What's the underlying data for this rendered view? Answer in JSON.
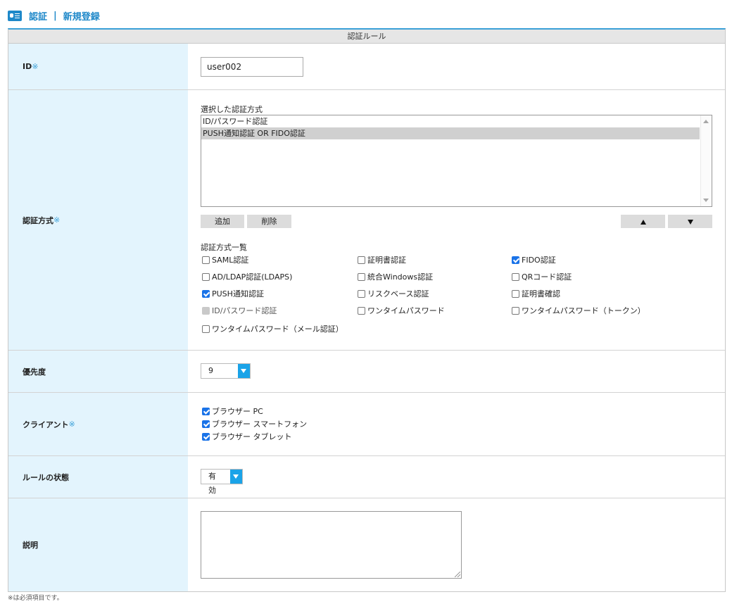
{
  "header": {
    "breadcrumb_1": "認証",
    "separator": "|",
    "breadcrumb_2": "新規登録",
    "icon": "id-card-icon"
  },
  "section_title": "認証ルール",
  "required_mark": "※",
  "id_field": {
    "label": "ID",
    "value": "user002"
  },
  "auth_method": {
    "label": "認証方式",
    "selected_heading": "選択した認証方式",
    "selected_items": [
      "ID/パスワード認証",
      "PUSH通知認証 OR FIDO認証"
    ],
    "selected_index": 1,
    "add_button": "追加",
    "delete_button": "削除",
    "list_heading": "認証方式一覧",
    "options": [
      {
        "label": "SAML認証",
        "checked": false,
        "disabled": false
      },
      {
        "label": "証明書認証",
        "checked": false,
        "disabled": false
      },
      {
        "label": "FIDO認証",
        "checked": true,
        "disabled": false
      },
      {
        "label": "AD/LDAP認証(LDAPS)",
        "checked": false,
        "disabled": false
      },
      {
        "label": "統合Windows認証",
        "checked": false,
        "disabled": false
      },
      {
        "label": "QRコード認証",
        "checked": false,
        "disabled": false
      },
      {
        "label": "PUSH通知認証",
        "checked": true,
        "disabled": false
      },
      {
        "label": "リスクベース認証",
        "checked": false,
        "disabled": false
      },
      {
        "label": "証明書確認",
        "checked": false,
        "disabled": false
      },
      {
        "label": "ID/パスワード認証",
        "checked": true,
        "disabled": true
      },
      {
        "label": "ワンタイムパスワード",
        "checked": false,
        "disabled": false
      },
      {
        "label": "ワンタイムパスワード（トークン）",
        "checked": false,
        "disabled": false
      },
      {
        "label": "ワンタイムパスワード（メール認証）",
        "checked": false,
        "disabled": false
      }
    ]
  },
  "priority": {
    "label": "優先度",
    "value": "9"
  },
  "client": {
    "label": "クライアント",
    "options": [
      {
        "label": "ブラウザー PC",
        "checked": true
      },
      {
        "label": "ブラウザー スマートフォン",
        "checked": true
      },
      {
        "label": "ブラウザー タブレット",
        "checked": true
      }
    ]
  },
  "rule_state": {
    "label": "ルールの状態",
    "value": "有効"
  },
  "description": {
    "label": "説明",
    "value": ""
  },
  "footnote": "※は必須項目です。",
  "colors": {
    "accent": "#3aa0d8",
    "label_bg": "#e3f4fd",
    "dropdown": "#1aa3e8",
    "checkbox": "#1a73e8"
  }
}
